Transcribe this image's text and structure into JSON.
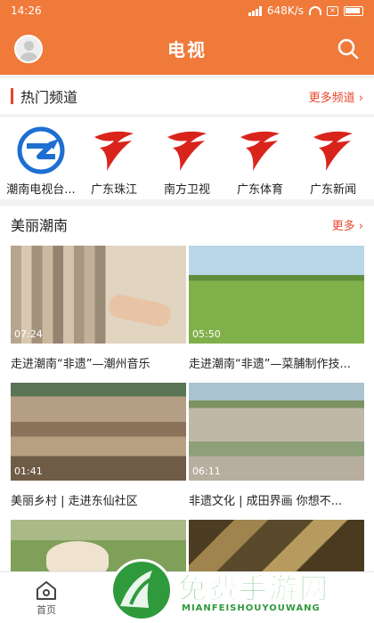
{
  "status": {
    "time": "14:26",
    "speed": "648K/s",
    "battery_glyph": "battery-icon"
  },
  "header": {
    "title": "电视",
    "avatar_icon": "avatar-icon",
    "search_icon": "search-icon"
  },
  "hot_channels": {
    "title": "热门频道",
    "more": "更多频道",
    "items": [
      {
        "name": "潮南电视台...",
        "icon": "chaonan-tv-logo"
      },
      {
        "name": "广东珠江",
        "icon": "guangdong-tv-logo"
      },
      {
        "name": "南方卫视",
        "icon": "guangdong-tv-logo"
      },
      {
        "name": "广东体育",
        "icon": "guangdong-tv-logo"
      },
      {
        "name": "广东新闻",
        "icon": "guangdong-tv-logo"
      }
    ]
  },
  "beautiful_chaonan": {
    "title": "美丽潮南",
    "more": "更多",
    "videos": [
      {
        "duration": "07:24",
        "caption": "走进潮南“非遗”—潮州音乐"
      },
      {
        "duration": "05:50",
        "caption": "走进潮南“非遗”—菜脯制作技..."
      },
      {
        "duration": "01:41",
        "caption": "美丽乡村 | 走进东仙社区"
      },
      {
        "duration": "06:11",
        "caption": "非遗文化 | 成田界画 你想不..."
      },
      {
        "duration": "",
        "caption": ""
      },
      {
        "duration": "",
        "caption": ""
      }
    ]
  },
  "tabbar": {
    "home_label": "首页",
    "home_icon": "home-icon"
  },
  "watermark": {
    "text": "免费手游网",
    "sub": "MIANFEISHOUYOUWANG"
  },
  "colors": {
    "header": "#ef7a3a",
    "accent": "#e8452e",
    "watermark": "#2f9a3c"
  }
}
